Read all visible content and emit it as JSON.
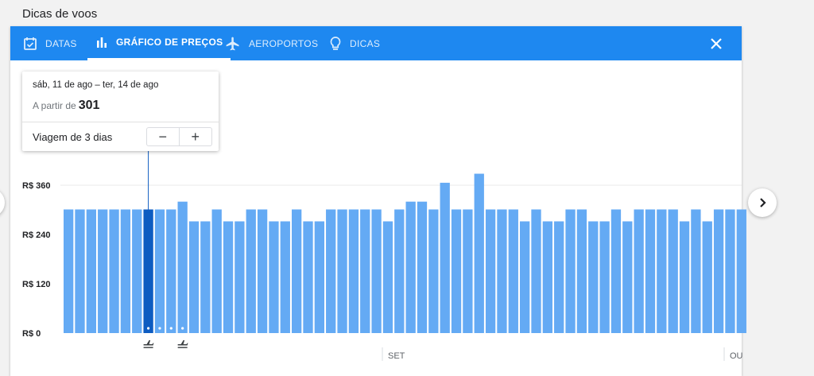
{
  "page_title": "Dicas de voos",
  "tabs": [
    {
      "label": "DATAS",
      "icon": "calendar-icon",
      "active": false
    },
    {
      "label": "GRÁFICO DE PREÇOS",
      "icon": "bar-chart-icon",
      "active": true
    },
    {
      "label": "AEROPORTOS",
      "icon": "airplane-icon",
      "active": false
    },
    {
      "label": "DICAS",
      "icon": "lightbulb-icon",
      "active": false
    }
  ],
  "popup": {
    "dates": "sáb, 11 de ago – ter, 14 de ago",
    "from_label": "A partir de",
    "price": "301",
    "trip_label": "Viagem de 3 dias",
    "minus": "−",
    "plus": "+"
  },
  "colors": {
    "accent": "#1e88f0",
    "bar": "#64aaf4",
    "bar_selected": "#0d5cc1"
  },
  "chart_data": {
    "type": "bar",
    "y_ticks": [
      "R$ 360",
      "R$ 240",
      "R$ 120",
      "R$ 0"
    ],
    "y_tick_values": [
      360,
      240,
      120,
      0
    ],
    "ylim": [
      0,
      400
    ],
    "values": [
      301,
      301,
      301,
      301,
      301,
      301,
      301,
      301,
      301,
      301,
      320,
      272,
      272,
      301,
      272,
      272,
      301,
      301,
      272,
      272,
      301,
      272,
      272,
      301,
      301,
      301,
      301,
      301,
      272,
      301,
      320,
      320,
      301,
      366,
      301,
      301,
      388,
      301,
      301,
      301,
      272,
      301,
      272,
      272,
      301,
      301,
      272,
      272,
      301,
      272,
      301,
      301,
      301,
      301,
      272,
      301,
      272,
      301,
      301,
      301
    ],
    "selected_index": 7,
    "month_labels": [
      "SET",
      "OU"
    ]
  }
}
